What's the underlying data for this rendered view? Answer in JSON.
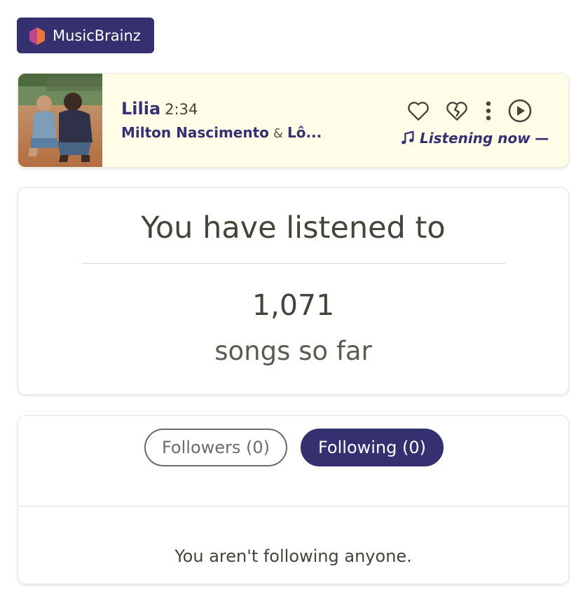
{
  "brand": {
    "label": "MusicBrainz",
    "colors": {
      "badge_bg": "#353070",
      "logo_left": "#ba478f",
      "logo_right": "#eb743b"
    }
  },
  "now_playing": {
    "title": "Lilia",
    "duration": "2:34",
    "artists": [
      "Milton Nascimento",
      "Lô..."
    ],
    "joiner": "&",
    "status": "Listening now —",
    "actions": [
      "love-icon",
      "hate-icon",
      "more-options-icon",
      "play-icon"
    ],
    "background": "#fffde8",
    "accent": "#353070"
  },
  "stats": {
    "heading": "You have listened to",
    "count": "1,071",
    "unit": "songs so far"
  },
  "follow": {
    "tabs": {
      "followers": "Followers (0)",
      "following": "Following (0)"
    },
    "active_tab": "following",
    "empty_message": "You aren't following anyone."
  }
}
